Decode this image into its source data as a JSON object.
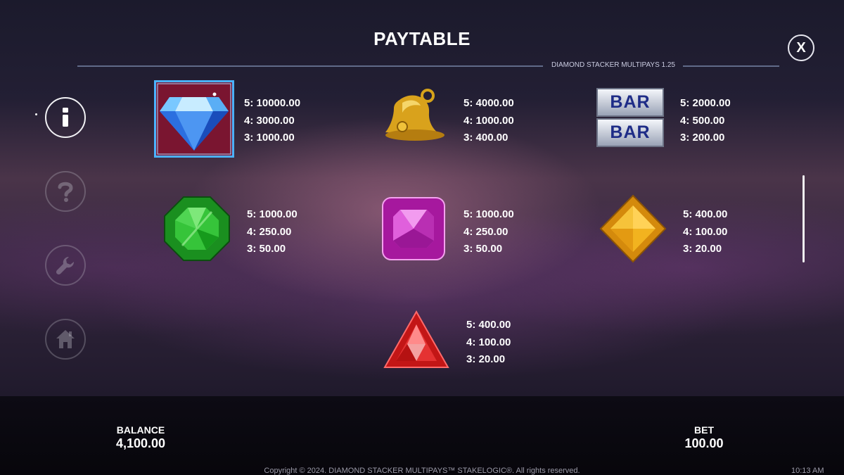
{
  "header": {
    "title": "PAYTABLE",
    "subtitle": "DIAMOND STACKER MULTIPAYS 1.25",
    "close_label": "X"
  },
  "sidebar": {
    "items": [
      {
        "name": "info",
        "icon": "info-icon",
        "active": true
      },
      {
        "name": "help",
        "icon": "question-icon",
        "active": false
      },
      {
        "name": "settings",
        "icon": "wrench-icon",
        "active": false
      },
      {
        "name": "home",
        "icon": "home-icon",
        "active": false
      }
    ]
  },
  "paytable": [
    {
      "symbol": "diamond-icon",
      "pays": [
        "5: 10000.00",
        "4: 3000.00",
        "3: 1000.00"
      ]
    },
    {
      "symbol": "bell-icon",
      "pays": [
        "5: 4000.00",
        "4: 1000.00",
        "3: 400.00"
      ]
    },
    {
      "symbol": "double-bar-icon",
      "bar_text": "BAR",
      "pays": [
        "5: 2000.00",
        "4: 500.00",
        "3: 200.00"
      ]
    },
    {
      "symbol": "green-gem-icon",
      "pays": [
        "5: 1000.00",
        "4: 250.00",
        "3: 50.00"
      ]
    },
    {
      "symbol": "pink-gem-icon",
      "pays": [
        "5: 1000.00",
        "4: 250.00",
        "3: 50.00"
      ]
    },
    {
      "symbol": "yellow-gem-icon",
      "pays": [
        "5: 400.00",
        "4: 100.00",
        "3: 20.00"
      ]
    },
    {
      "symbol": "red-gem-icon",
      "pays": [
        "5: 400.00",
        "4: 100.00",
        "3: 20.00"
      ]
    }
  ],
  "footer": {
    "balance_label": "BALANCE",
    "balance_value": "4,100.00",
    "bet_label": "BET",
    "bet_value": "100.00",
    "copyright": "Copyright © 2024. DIAMOND STACKER MULTIPAYS™ STAKELOGIC®. All rights reserved.",
    "time": "10:13 AM"
  }
}
